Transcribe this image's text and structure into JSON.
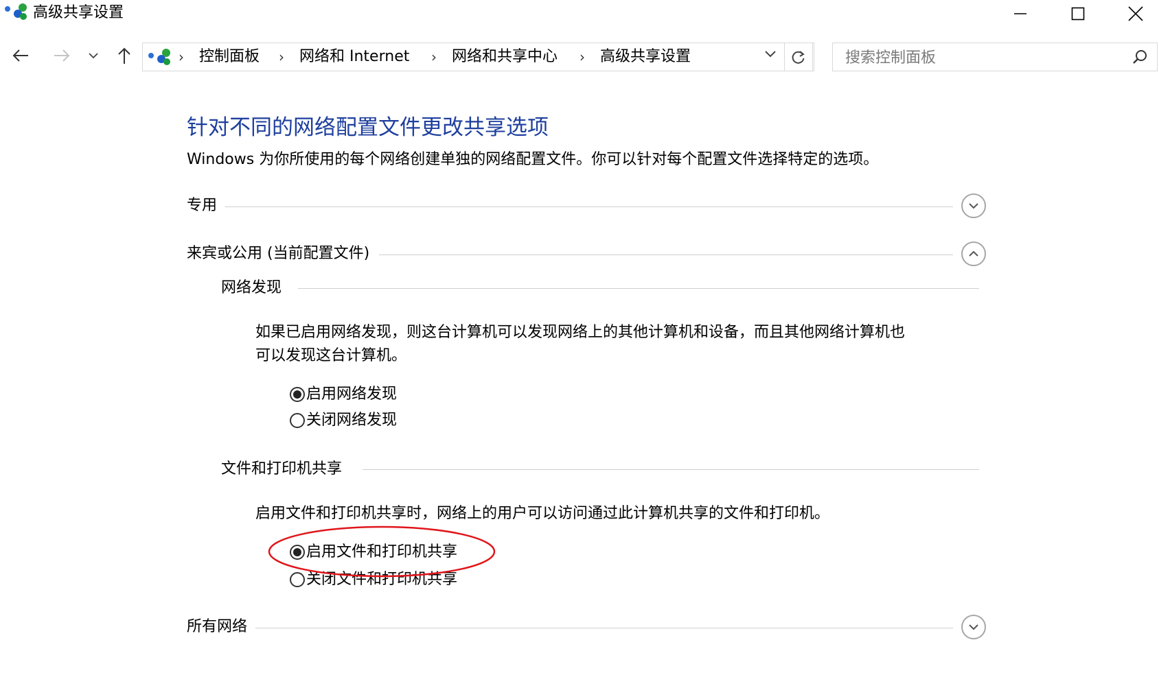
{
  "window": {
    "title": "高级共享设置",
    "buttons": {
      "minimize": "minimize-icon",
      "maximize": "maximize-icon",
      "close": "close-icon"
    }
  },
  "nav": {
    "back": "back-arrow-icon",
    "forward": "forward-arrow-icon",
    "recent": "chevron-down-icon",
    "up": "up-arrow-icon",
    "breadcrumbs": [
      "控制面板",
      "网络和 Internet",
      "网络和共享中心",
      "高级共享设置"
    ],
    "search_placeholder": "搜索控制面板"
  },
  "content": {
    "heading": "针对不同的网络配置文件更改共享选项",
    "description": "Windows 为你所使用的每个网络创建单独的网络配置文件。你可以针对每个配置文件选择特定的选项。",
    "sections": [
      {
        "title": "专用",
        "expanded": false
      },
      {
        "title": "来宾或公用 (当前配置文件)",
        "expanded": true
      },
      {
        "title": "所有网络",
        "expanded": false
      }
    ],
    "network_discovery": {
      "title": "网络发现",
      "text_line1": "如果已启用网络发现，则这台计算机可以发现网络上的其他计算机和设备，而且其他网络计算机也",
      "text_line2": "可以发现这台计算机。",
      "options": [
        {
          "label": "启用网络发现",
          "selected": true
        },
        {
          "label": "关闭网络发现",
          "selected": false
        }
      ]
    },
    "file_printer_sharing": {
      "title": "文件和打印机共享",
      "text": "启用文件和打印机共享时，网络上的用户可以访问通过此计算机共享的文件和打印机。",
      "options": [
        {
          "label": "启用文件和打印机共享",
          "selected": true
        },
        {
          "label": "关闭文件和打印机共享",
          "selected": false
        }
      ]
    }
  },
  "colors": {
    "heading": "#1e3f9e",
    "annotation": "#e0161b",
    "divider": "#cfcfcf"
  }
}
